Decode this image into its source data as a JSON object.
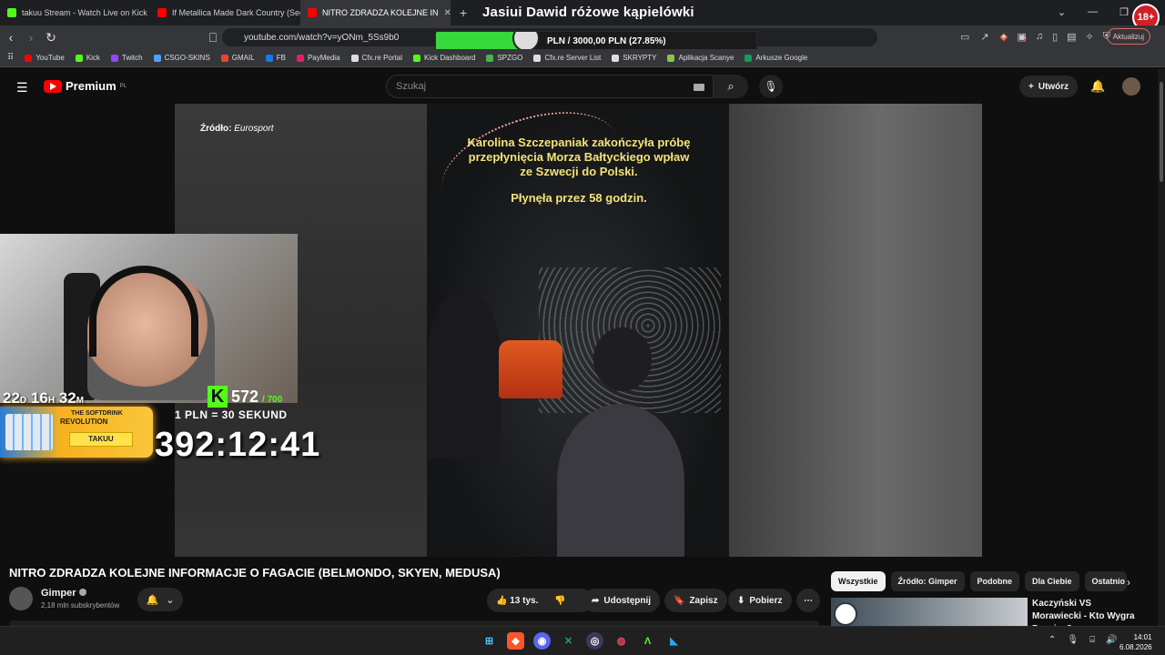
{
  "browser": {
    "tabs": [
      {
        "label": "takuu Stream - Watch Live on Kick",
        "color": "#53fc18"
      },
      {
        "label": "If Metallica Made Dark Country (Seek",
        "color": "#ff0000"
      },
      {
        "label": "NITRO ZDRADZA KOLEJNE IN",
        "color": "#ff0000",
        "active": true
      }
    ],
    "new_tab": "+",
    "url": "youtube.com/watch?v=yONm_5Ss9b0",
    "update_label": "Aktualizuj",
    "bookmarks": [
      {
        "label": "YouTube",
        "color": "#ff0000"
      },
      {
        "label": "Kick",
        "color": "#53fc18"
      },
      {
        "label": "Twitch",
        "color": "#9146ff"
      },
      {
        "label": "CSGO-SKINS",
        "color": "#4aa3ff"
      },
      {
        "label": "GMAIL",
        "color": "#ea4335"
      },
      {
        "label": "FB",
        "color": "#1877f2"
      },
      {
        "label": "PayMedia",
        "color": "#e91e63"
      },
      {
        "label": "Cfx.re Portal",
        "color": "#dddddd"
      },
      {
        "label": "Kick Dashboard",
        "color": "#53fc18"
      },
      {
        "label": "SPZGO",
        "color": "#4caf50"
      },
      {
        "label": "Cfx.re Server List",
        "color": "#dddddd"
      },
      {
        "label": "SKRYPTY",
        "color": "#dddddd"
      },
      {
        "label": "Aplikacja Scanye",
        "color": "#8bc34a"
      },
      {
        "label": "Arkusze Google",
        "color": "#0f9d58"
      }
    ]
  },
  "overlay": {
    "stream_title": "Jasiui Dawid różowe kąpielówki",
    "donation_bar": "PLN / 3000,00 PLN  (27.85%)",
    "donation_progress": 27.85,
    "age_badge": "18+",
    "countdown_days": "22",
    "countdown_d": "D",
    "countdown_hours": "16",
    "countdown_h": "H",
    "countdown_minutes": "32",
    "countdown_m": "M",
    "kick_count": "572",
    "kick_goal": "/ 700",
    "rate": "1 PLN = 30 SEKUND",
    "big_timer": "392:12:41",
    "ad_line1": "THE SOFTDRINK",
    "ad_line2": "REVOLUTION",
    "ad_button": "TAKUU"
  },
  "youtube": {
    "brand": "Premium",
    "brand_region": "PL",
    "search_placeholder": "Szukaj",
    "create_label": "Utwórz",
    "video": {
      "source_label": "Źródło:",
      "source_name": "Eurosport",
      "caption_line1": "Karolina Szczepaniak zakończyła próbę",
      "caption_line2": "przepłynięcia Morza Bałtyckiego wpław",
      "caption_line3": "ze Szwecji do Polski.",
      "caption_line4": "Płynęła przez 58 godzin."
    },
    "title": "NITRO ZDRADZA KOLEJNE INFORMACJE O FAGACIE (BELMONDO, SKYEN, MEDUSA)",
    "channel": "Gimper",
    "subscribers": "2,18 mln subskrybentów",
    "likes": "13 tys.",
    "share": "Udostępnij",
    "save": "Zapisz",
    "download": "Pobierz",
    "chips": [
      "Wszystkie",
      "Źródło: Gimper",
      "Podobne",
      "Dla Ciebie",
      "Ostatnio"
    ],
    "rec_title": "Kaczyński VS Morawiecki - Kto Wygra Prawice?"
  },
  "taskbar": {
    "time": "14:01",
    "date": "6.08.2026"
  }
}
